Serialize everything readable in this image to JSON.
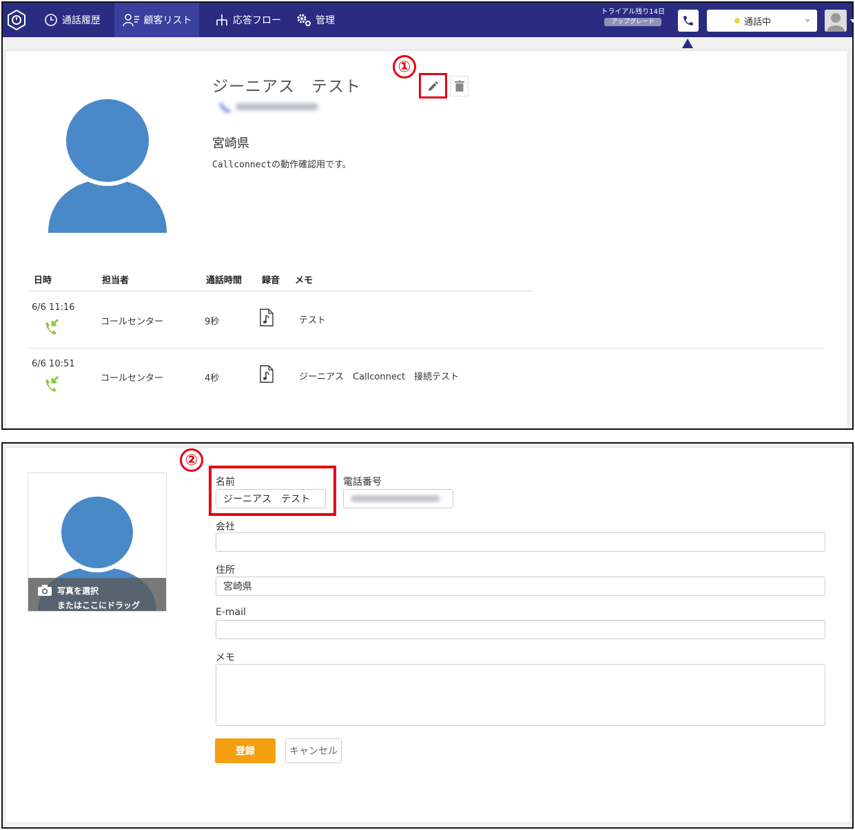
{
  "colors": {
    "nav_bg": "#2a2c82",
    "nav_active": "#3b3f9e",
    "highlight_red": "#e50012",
    "avatar_blue": "#4a89c8",
    "call_green": "#8cc63f",
    "submit_orange": "#f5a011",
    "status_yellow": "#f3d43b"
  },
  "nav": {
    "items": [
      {
        "label": "通話履歴",
        "icon": "clock-icon"
      },
      {
        "label": "顧客リスト",
        "icon": "user-list-icon"
      },
      {
        "label": "応答フロー",
        "icon": "flow-icon"
      },
      {
        "label": "管理",
        "icon": "gear-icon"
      }
    ],
    "trial": "トライアル残り14日",
    "upgrade": "アップグレード",
    "status": "通話中"
  },
  "customer": {
    "name": "ジーニアス　テスト",
    "prefecture": "宮崎県",
    "memo": "Callconnectの動作確認用です。"
  },
  "callouts": {
    "one": "①",
    "two": "②"
  },
  "history": {
    "headers": [
      "日時",
      "担当者",
      "通話時間",
      "録音",
      "メモ"
    ],
    "rows": [
      {
        "datetime": "6/6 11:16",
        "agent": "コールセンター",
        "duration": "9秒",
        "memo": "テスト"
      },
      {
        "datetime": "6/6 10:51",
        "agent": "コールセンター",
        "duration": "4秒",
        "memo": "ジーニアス　Callconnect　接続テスト"
      }
    ]
  },
  "form": {
    "photo_line1": "写真を選択",
    "photo_line2": "またはここにドラッグ",
    "name_label": "名前",
    "name_value": "ジーニアス　テスト",
    "phone_label": "電話番号",
    "company_label": "会社",
    "company_value": "",
    "address_label": "住所",
    "address_value": "宮崎県",
    "email_label": "E-mail",
    "email_value": "",
    "memo_label": "メモ",
    "memo_value": "",
    "submit": "登録",
    "cancel": "キャンセル"
  }
}
